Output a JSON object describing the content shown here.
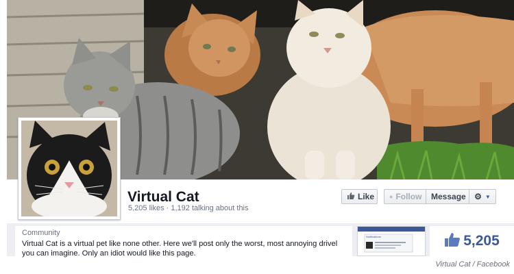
{
  "page": {
    "name": "Virtual Cat",
    "stats": "5,205 likes · 1,192 talking about this"
  },
  "actions": {
    "like_label": "Like",
    "follow_label": "Follow",
    "message_label": "Message"
  },
  "about": {
    "category": "Community",
    "description": "Virtual Cat is a virtual pet like none other. Here we'll post only the worst, most annoying drivel you can imagine. Only an idiot would like this page."
  },
  "likes_box": {
    "count": "5,205"
  },
  "thumbnail": {
    "header": "Notifications"
  },
  "credit": "Virtual Cat / Facebook",
  "colors": {
    "brand_blue": "#3b5998",
    "muted_text": "#6a7180"
  },
  "icons": [
    "thumbs-up-icon",
    "rss-icon",
    "gear-icon",
    "chevron-down-icon"
  ]
}
